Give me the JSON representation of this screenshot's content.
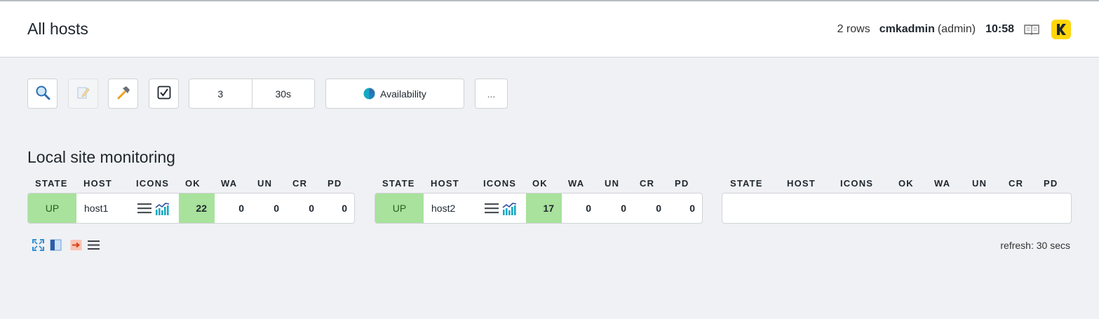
{
  "header": {
    "title": "All hosts",
    "rows_count": "2 rows",
    "user": "cmkadmin",
    "role": "(admin)",
    "time": "10:58"
  },
  "toolbar": {
    "icons": [
      "search-icon",
      "edit-icon",
      "hammer-icon",
      "checkbox-icon"
    ],
    "columns_value": "3",
    "refresh_value": "30s",
    "availability_label": "Availability",
    "more_label": "..."
  },
  "section": {
    "title": "Local site monitoring"
  },
  "columns": [
    "STATE",
    "HOST",
    "ICONS",
    "OK",
    "WA",
    "UN",
    "CR",
    "PD"
  ],
  "hosts": [
    {
      "state": "UP",
      "host": "host1",
      "ok": "22",
      "wa": "0",
      "un": "0",
      "cr": "0",
      "pd": "0"
    },
    {
      "state": "UP",
      "host": "host2",
      "ok": "17",
      "wa": "0",
      "un": "0",
      "cr": "0",
      "pd": "0"
    }
  ],
  "footer": {
    "icons": [
      "fullscreen-icon",
      "sidebar-toggle-icon",
      "export-icon",
      "menu-icon"
    ],
    "refresh_text": "refresh: 30 secs"
  },
  "colors": {
    "state_up": "#a8e29c",
    "logo": "#ffd60a",
    "accent": "#15a8c4"
  }
}
